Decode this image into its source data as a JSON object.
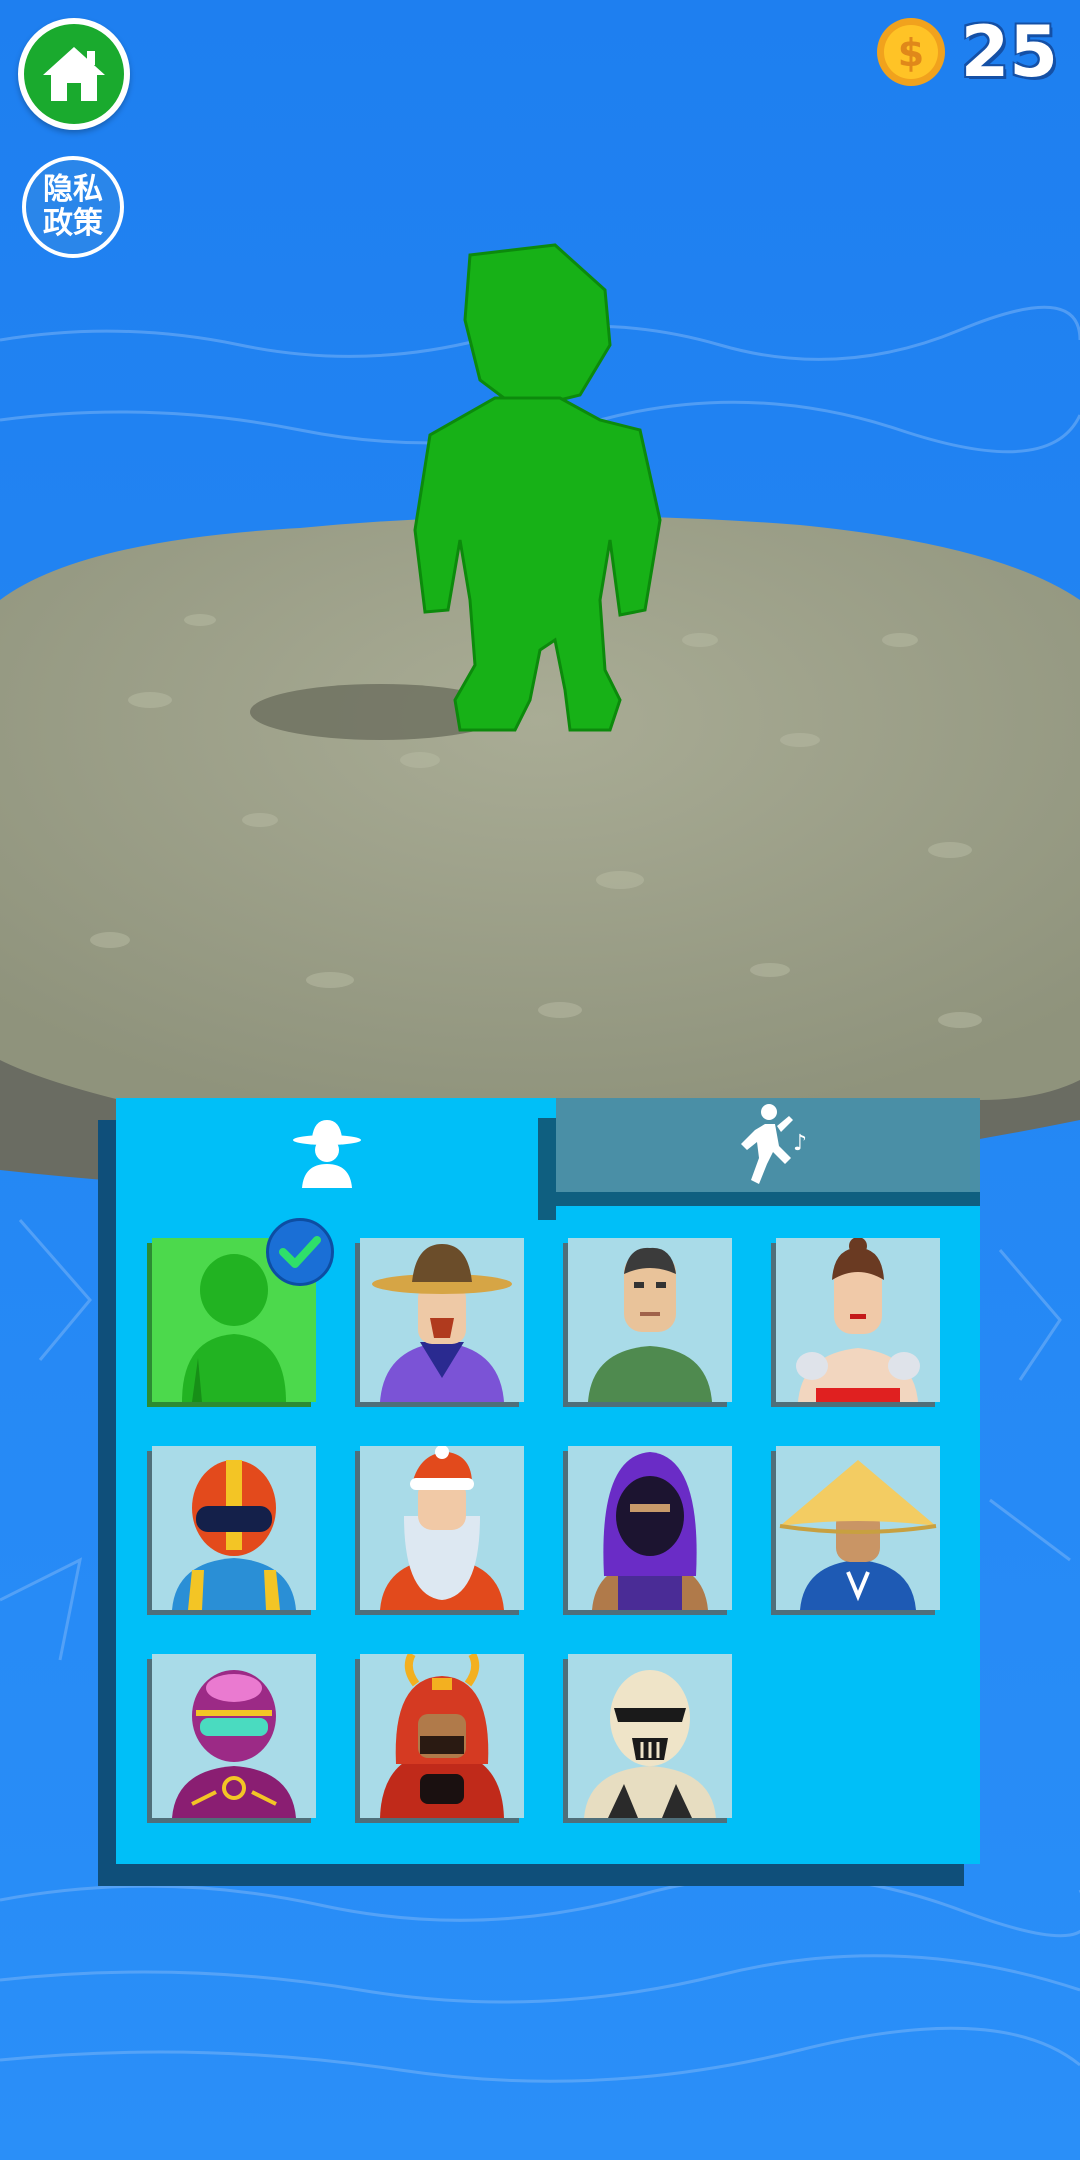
{
  "hud": {
    "home_button": "home",
    "privacy_label": "隐私政策",
    "coin_count": "25"
  },
  "tabs": [
    {
      "name": "outfits",
      "icon": "hat-person-icon",
      "selected": true
    },
    {
      "name": "dances",
      "icon": "dancing-figure-icon",
      "selected": false
    }
  ],
  "characters": [
    {
      "id": "green-stickman",
      "selected": true
    },
    {
      "id": "cowboy"
    },
    {
      "id": "soldier"
    },
    {
      "id": "fighter-woman"
    },
    {
      "id": "racer"
    },
    {
      "id": "santa"
    },
    {
      "id": "ninja"
    },
    {
      "id": "straw-hat"
    },
    {
      "id": "pink-robot"
    },
    {
      "id": "samurai"
    },
    {
      "id": "stormtrooper"
    }
  ],
  "colors": {
    "water": "#1f86f4",
    "platform": "#9a9e86",
    "panel": "#00bff8",
    "home": "#1aaa2e",
    "character": "#14b414"
  }
}
